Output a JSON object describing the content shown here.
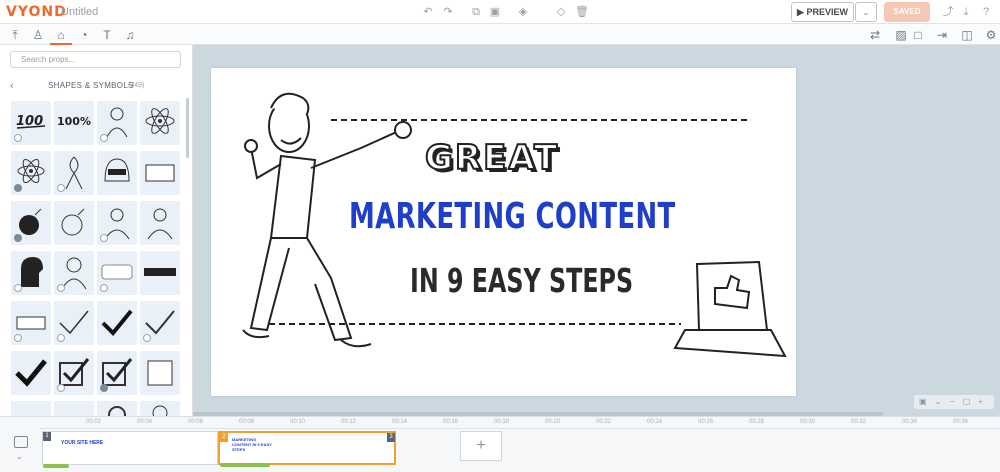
{
  "app": {
    "logo": "VYOND",
    "title": "Untitled"
  },
  "header": {
    "preview_label": "▶ PREVIEW",
    "preview_caret": "⌄",
    "saved_label": "SAVED",
    "icons": [
      "undo-icon",
      "redo-icon",
      "copy-icon",
      "paste-icon",
      "layer-icon",
      "paint-icon",
      "delete-icon",
      "share-icon",
      "download-icon",
      "help-icon"
    ]
  },
  "category_tabs": [
    "upload-icon",
    "character-icon",
    "props-icon",
    "chart-icon",
    "text-icon",
    "audio-icon"
  ],
  "search": {
    "placeholder": "Search props..."
  },
  "section": {
    "title": "SHAPES & SYMBOLS",
    "count": "(349)"
  },
  "props": [
    {
      "label": "100",
      "row": 0,
      "col": 0
    },
    {
      "label": "100%",
      "row": 0,
      "col": 1
    },
    {
      "label": "",
      "row": 0,
      "col": 2
    },
    {
      "label": "",
      "row": 0,
      "col": 3
    }
  ],
  "canvas_text": {
    "great": "GREAT",
    "marketing": "MARKETING CONTENT",
    "steps": "IN 9 EASY STEPS"
  },
  "timeline": {
    "ticks": [
      "00:02",
      "00:04",
      "00:06",
      "00:08",
      "00:10",
      "00:12",
      "00:14",
      "00:16",
      "00:18",
      "00:20",
      "00:22",
      "00:24",
      "00:26",
      "00:28",
      "00:30",
      "00:32",
      "00:34",
      "00:36"
    ],
    "scenes": [
      {
        "num": "1",
        "title": "YOUR SITE HERE"
      },
      {
        "num": "2",
        "title": "MARKETING CONTENT IN 9 EASY STEPS"
      }
    ],
    "end_marker": "3",
    "add_label": "+"
  },
  "colors": {
    "accent": "#f0682a",
    "headline_blue": "#1f3fc9",
    "stage_bg": "#cbd8e0"
  }
}
